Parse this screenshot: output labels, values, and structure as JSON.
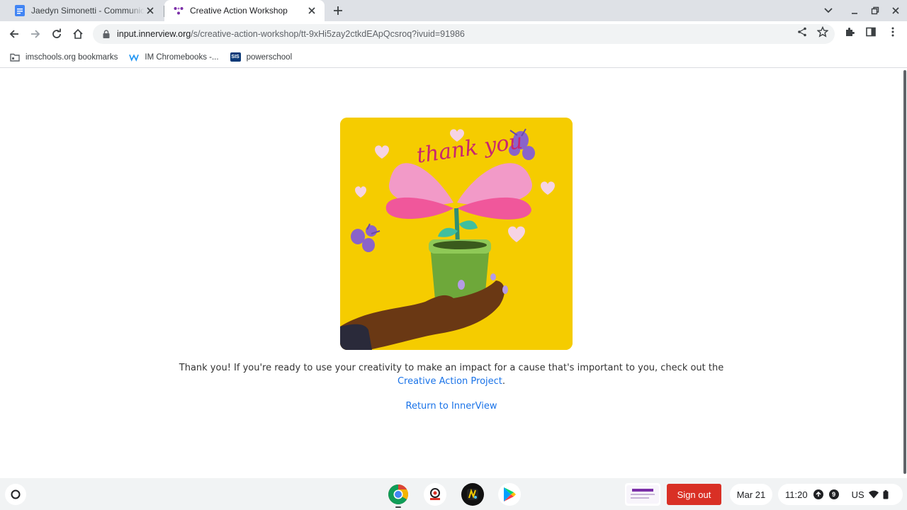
{
  "browser": {
    "tabs": [
      {
        "title": "Jaedyn Simonetti - Communicat",
        "icon": "google-docs-icon",
        "active": false
      },
      {
        "title": "Creative Action Workshop",
        "icon": "innerview-icon",
        "active": true
      }
    ],
    "url_host": "input.innerview.org",
    "url_path": "/s/creative-action-workshop/tt-9xHi5zay2ctkdEApQcsroq?ivuid=91986",
    "bookmarks": [
      {
        "label": "imschools.org bookmarks",
        "icon": "folder-icon"
      },
      {
        "label": "IM Chromebooks -...",
        "icon": "weebly-icon"
      },
      {
        "label": "powerschool",
        "icon": "sis-icon",
        "icon_text": "SIS"
      }
    ]
  },
  "page": {
    "card_text": "thank you",
    "message_before": "Thank you! If you're ready to use your creativity to make an impact for a cause that's important to you, check out the ",
    "message_link": "Creative Action Project",
    "message_after": ".",
    "return_link": "Return to InnerView"
  },
  "shelf": {
    "sign_out": "Sign out",
    "date": "Mar 21",
    "time": "11:20",
    "notification_count": "9",
    "input_method": "US"
  },
  "colors": {
    "card_bg": "#f5cc00",
    "link": "#1a73e8",
    "sign_out": "#d93025"
  }
}
